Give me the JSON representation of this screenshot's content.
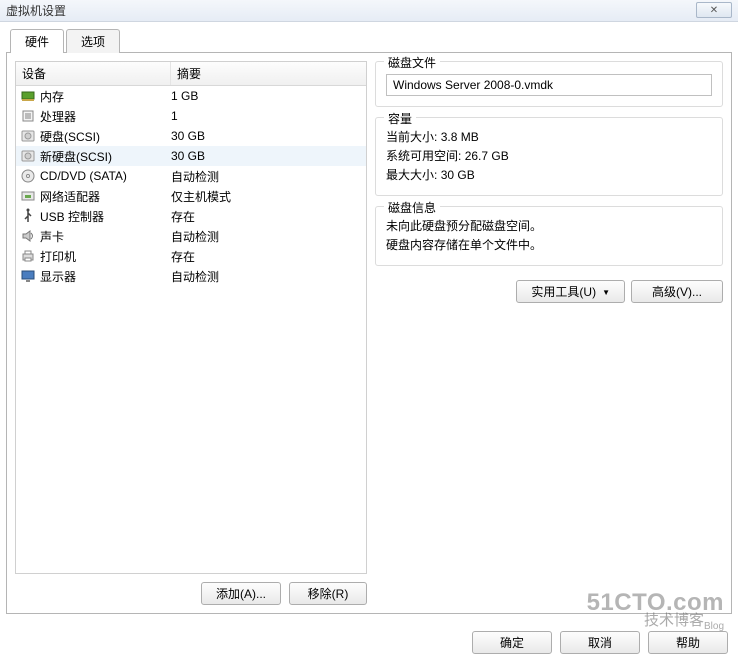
{
  "window": {
    "title": "虚拟机设置",
    "close_glyph": "✕"
  },
  "tabs": {
    "hardware": "硬件",
    "options": "选项"
  },
  "headers": {
    "device": "设备",
    "summary": "摘要"
  },
  "devices": [
    {
      "icon": "memory-icon",
      "name": "内存",
      "summary": "1 GB",
      "selected": false
    },
    {
      "icon": "cpu-icon",
      "name": "处理器",
      "summary": "1",
      "selected": false
    },
    {
      "icon": "disk-icon",
      "name": "硬盘(SCSI)",
      "summary": "30 GB",
      "selected": false
    },
    {
      "icon": "disk-icon",
      "name": "新硬盘(SCSI)",
      "summary": "30 GB",
      "selected": true
    },
    {
      "icon": "cd-icon",
      "name": "CD/DVD (SATA)",
      "summary": "自动检测",
      "selected": false
    },
    {
      "icon": "nic-icon",
      "name": "网络适配器",
      "summary": "仅主机模式",
      "selected": false
    },
    {
      "icon": "usb-icon",
      "name": "USB 控制器",
      "summary": "存在",
      "selected": false
    },
    {
      "icon": "sound-icon",
      "name": "声卡",
      "summary": "自动检测",
      "selected": false
    },
    {
      "icon": "printer-icon",
      "name": "打印机",
      "summary": "存在",
      "selected": false
    },
    {
      "icon": "display-icon",
      "name": "显示器",
      "summary": "自动检测",
      "selected": false
    }
  ],
  "left_buttons": {
    "add": "添加(A)...",
    "remove": "移除(R)"
  },
  "detail": {
    "disk_file_label": "磁盘文件",
    "disk_file_value": "Windows Server 2008-0.vmdk",
    "capacity_label": "容量",
    "current_size_label": "当前大小:",
    "current_size_value": "3.8 MB",
    "free_space_label": "系统可用空间:",
    "free_space_value": "26.7 GB",
    "max_size_label": "最大大小:",
    "max_size_value": "30 GB",
    "disk_info_label": "磁盘信息",
    "info_line1": "未向此硬盘预分配磁盘空间。",
    "info_line2": "硬盘内容存储在单个文件中。",
    "utilities_btn": "实用工具(U)",
    "advanced_btn": "高级(V)..."
  },
  "bottom": {
    "ok": "确定",
    "cancel": "取消",
    "help": "帮助"
  },
  "watermark": {
    "line1": "51CTO.com",
    "line2": "技术博客",
    "suffix": "Blog"
  }
}
